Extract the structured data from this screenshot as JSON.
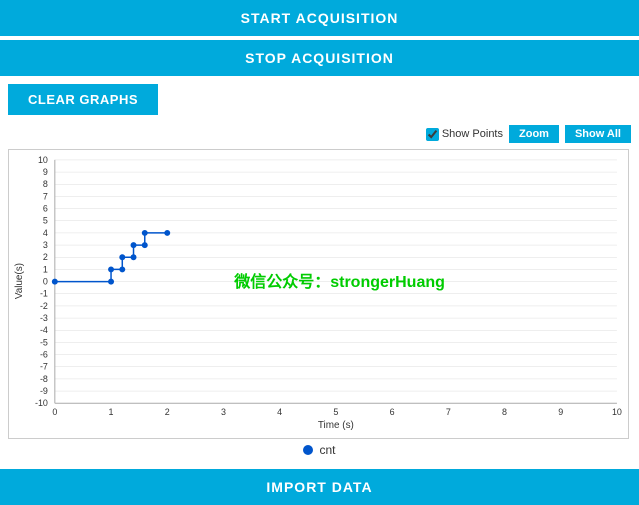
{
  "header": {
    "start_acquisition": "START ACQUISITION",
    "stop_acquisition": "STOP ACQUISITION"
  },
  "toolbar": {
    "clear_graphs": "CLEAR GRAPHS",
    "show_points_label": "Show Points",
    "zoom_label": "Zoom",
    "show_all_label": "Show All"
  },
  "chart": {
    "y_axis_label": "Value(s)",
    "x_axis_label": "Time (s)",
    "x_min": 0,
    "x_max": 10,
    "y_min": -10,
    "y_max": 10,
    "watermark": "微信公众号：strongerHuang",
    "data_points": [
      {
        "x": 0,
        "y": 0
      },
      {
        "x": 1.0,
        "y": 0
      },
      {
        "x": 1.0,
        "y": 1
      },
      {
        "x": 1.2,
        "y": 1
      },
      {
        "x": 1.2,
        "y": 2
      },
      {
        "x": 1.4,
        "y": 2
      },
      {
        "x": 1.4,
        "y": 3
      },
      {
        "x": 1.6,
        "y": 3
      },
      {
        "x": 1.6,
        "y": 4
      },
      {
        "x": 2.0,
        "y": 4
      }
    ]
  },
  "legend": {
    "dot_color": "#0055cc",
    "label": "cnt"
  },
  "footer": {
    "import_data": "IMPORT DATA"
  }
}
